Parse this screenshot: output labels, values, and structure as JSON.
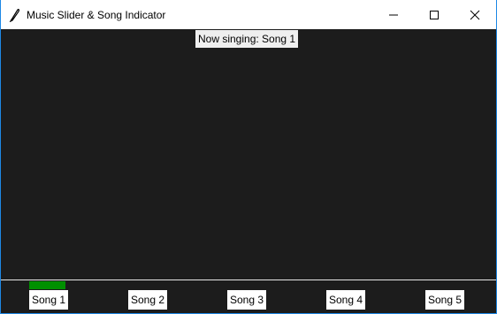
{
  "window": {
    "title": "Music Slider & Song Indicator",
    "app_icon": "feather-icon",
    "controls": [
      "minimize-icon",
      "maximize-icon",
      "close-icon"
    ]
  },
  "status": {
    "now_singing": "Now singing: Song 1"
  },
  "indicator": {
    "current_song_index": 0,
    "color": "#009000"
  },
  "songs": [
    {
      "label": "Song 1"
    },
    {
      "label": "Song 2"
    },
    {
      "label": "Song 3"
    },
    {
      "label": "Song 4"
    },
    {
      "label": "Song 5"
    }
  ],
  "colors": {
    "background": "#1c1c1c",
    "track_line": "#e6e6e6",
    "window_border": "#1e88e5"
  }
}
